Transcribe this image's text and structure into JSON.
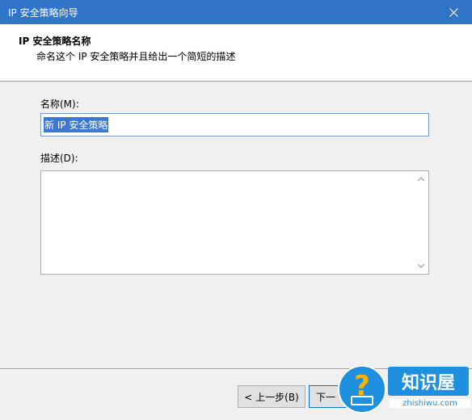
{
  "window": {
    "title": "IP 安全策略向导"
  },
  "header": {
    "title": "IP 安全策略名称",
    "subtitle": "命名这个 IP 安全策略并且给出一个简短的描述"
  },
  "form": {
    "name_label": "名称(M):",
    "name_value": "新 IP 安全策略",
    "desc_label": "描述(D):",
    "desc_value": ""
  },
  "buttons": {
    "back_label": "< 上一步(B)",
    "next_label": "下一"
  },
  "watermark": {
    "brand": "知识屋",
    "url": "zhishiwu.com"
  },
  "colors": {
    "titlebar": "#3275c8",
    "selection": "#3a78d4"
  }
}
